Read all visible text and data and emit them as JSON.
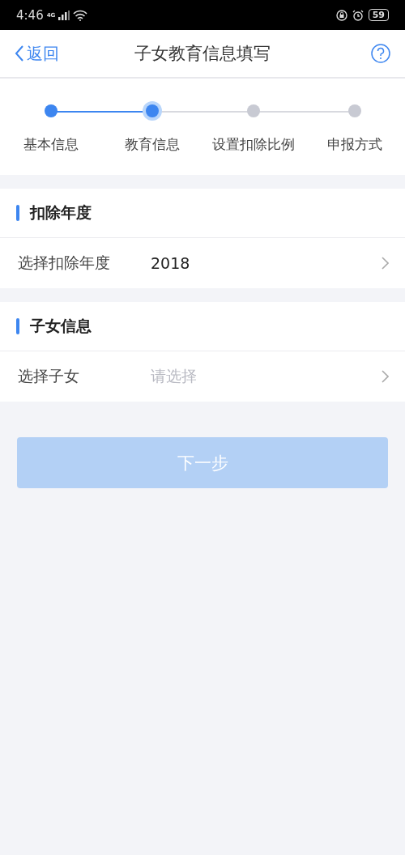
{
  "status_bar": {
    "time": "4:46",
    "network": "4G",
    "battery": "59"
  },
  "header": {
    "back": "返回",
    "title": "子女教育信息填写"
  },
  "steps": [
    {
      "label": "基本信息",
      "completed": true,
      "selected": false
    },
    {
      "label": "教育信息",
      "completed": false,
      "selected": true
    },
    {
      "label": "设置扣除比例",
      "completed": false,
      "selected": false
    },
    {
      "label": "申报方式",
      "completed": false,
      "selected": false
    }
  ],
  "sections": [
    {
      "title": "扣除年度",
      "row": {
        "label": "选择扣除年度",
        "value": "2018"
      }
    },
    {
      "title": "子女信息",
      "row": {
        "label": "选择子女",
        "placeholder": "请选择"
      }
    }
  ],
  "next_button": {
    "label": "下一步",
    "disabled": true
  }
}
